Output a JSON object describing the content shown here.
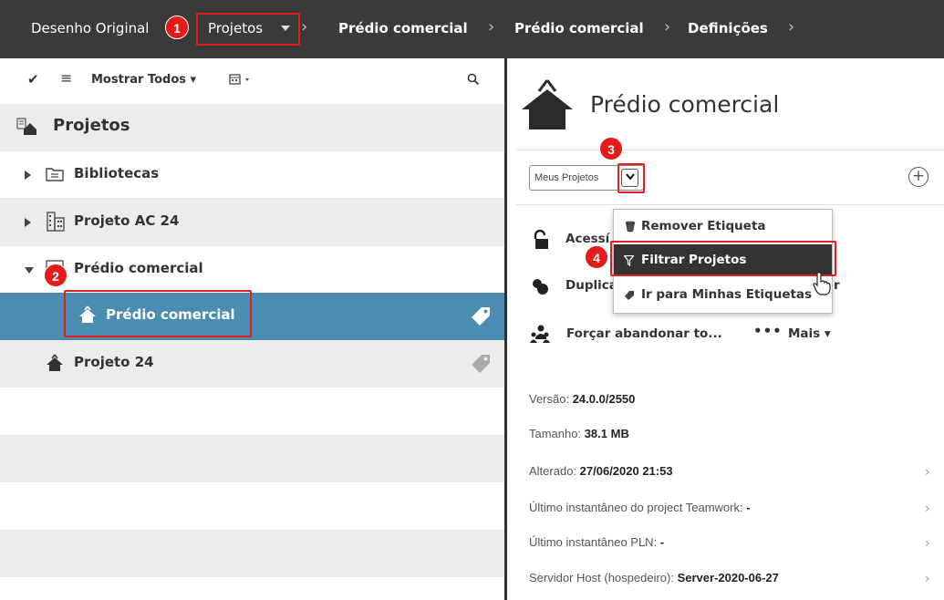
{
  "breadcrumb": {
    "items": [
      "Desenho Original",
      "Projetos",
      "Prédio comercial",
      "Prédio comercial",
      "Definições"
    ]
  },
  "annotations": [
    "1",
    "2",
    "3",
    "4"
  ],
  "left_toolbar": {
    "show_all_label": "Mostrar Todos"
  },
  "tree": {
    "root_label": "Projetos",
    "items": [
      {
        "label": "Bibliotecas"
      },
      {
        "label": "Projeto AC 24"
      },
      {
        "label": "Prédio comercial"
      },
      {
        "label": "Prédio comercial"
      },
      {
        "label": "Projeto 24"
      }
    ]
  },
  "detail": {
    "title": "Prédio comercial",
    "filter_value": "Meus Projetos",
    "actions": {
      "access": "Acessí",
      "duplicate": "Duplica",
      "duplicate_tail": "r",
      "force_leave": "Forçar abandonar to...",
      "more": "Mais"
    },
    "info": [
      {
        "label": "Versão: ",
        "value": "24.0.0/2550"
      },
      {
        "label": "Tamanho: ",
        "value": "38.1 MB"
      },
      {
        "label": "Alterado: ",
        "value": "27/06/2020 21:53"
      },
      {
        "label": "Último instantâneo do project Teamwork: ",
        "value": "-"
      },
      {
        "label": "Último instantâneo PLN: ",
        "value": "-"
      },
      {
        "label": "Servidor Host (hospedeiro): ",
        "value": "Server-2020-06-27"
      }
    ]
  },
  "menu": {
    "items": [
      {
        "label": "Remover Etiqueta",
        "icon": "trash-icon"
      },
      {
        "label": "Filtrar Projetos",
        "icon": "filter-icon"
      },
      {
        "label": "Ir para Minhas Etiquetas",
        "icon": "tag-icon"
      }
    ]
  },
  "colors": {
    "topbar": "#3a3a3a",
    "selected_row": "#4b8db0",
    "annotation_red": "#e31b1b",
    "menu_active": "#333333"
  }
}
